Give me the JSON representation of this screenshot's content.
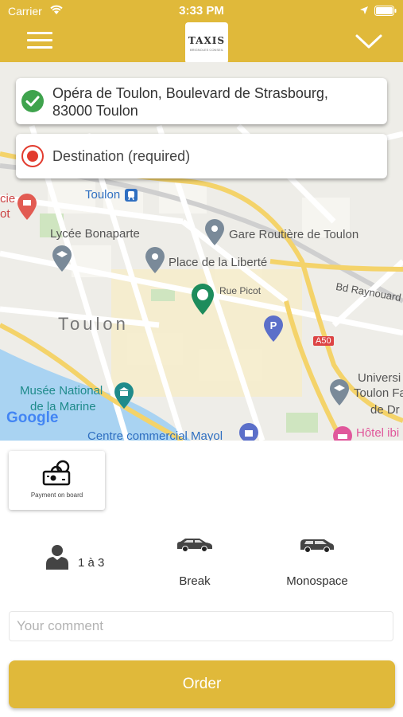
{
  "status_bar": {
    "carrier": "Carrier",
    "time": "3:33 PM"
  },
  "header": {
    "logo_main": "TAXIS",
    "logo_sub": "BRIGNOLES CONSEIL"
  },
  "map": {
    "pickup_address": "Opéra de Toulon, Boulevard de Strasbourg, 83000 Toulon",
    "destination_placeholder": "Destination (required)",
    "labels": {
      "toulon_station": "Toulon",
      "lycee": "Lycée Bonaparte",
      "gare": "Gare Routière de Toulon",
      "place": "Place de la Liberté",
      "rue_picot": "Rue Picot",
      "bd_raynouard": "Bd Raynouard",
      "city": "Toulon",
      "a50": "A50",
      "musee_1": "Musée National",
      "musee_2": "de la Marine",
      "univ_1": "Universi",
      "univ_2": "Toulon Fa",
      "univ_3": "de Dr",
      "centre": "Centre commercial Mayol",
      "hotel": "Hôtel ibi",
      "left_1": "cie",
      "left_2": "ot",
      "google": "Google"
    }
  },
  "payment": {
    "label": "Payment on board"
  },
  "options": {
    "passengers": "1 à 3",
    "break_label": "Break",
    "monospace_label": "Monospace"
  },
  "comment": {
    "placeholder": "Your comment",
    "value": ""
  },
  "order": {
    "label": "Order"
  },
  "colors": {
    "accent": "#e0b93a",
    "pickup": "#3fa34d",
    "destination": "#e23b2e"
  }
}
